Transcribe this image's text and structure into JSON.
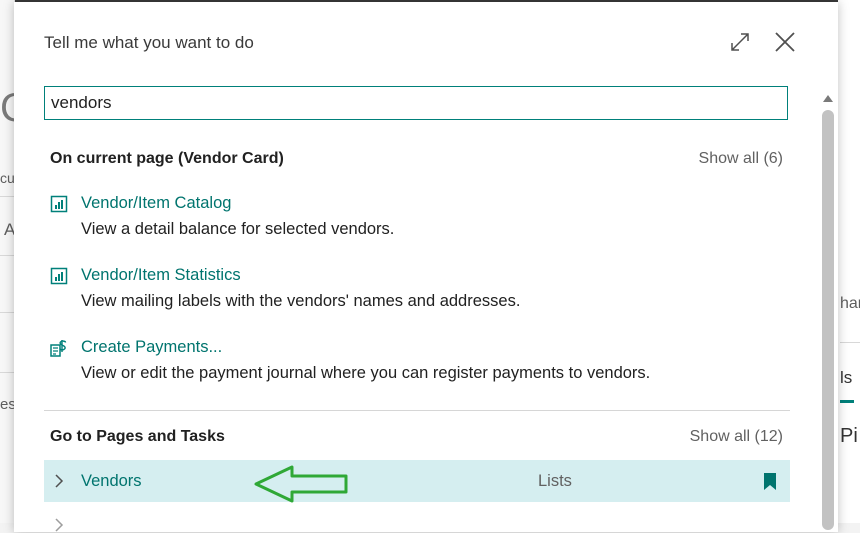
{
  "background": {
    "fragments": [
      "C",
      "cu",
      "A",
      "esi",
      "har",
      "ls",
      "Pi"
    ]
  },
  "dialog": {
    "title": "Tell me what you want to do",
    "expand_icon": "expand-icon",
    "close_icon": "close-icon"
  },
  "search": {
    "value": "vendors",
    "placeholder": ""
  },
  "current_page": {
    "heading": "On current page (Vendor Card)",
    "show_all": "Show all (6)",
    "items": [
      {
        "title": "Vendor/Item Catalog",
        "description": "View a detail balance for selected vendors.",
        "icon": "report-icon"
      },
      {
        "title": "Vendor/Item Statistics",
        "description": "View mailing labels with the vendors' names and addresses.",
        "icon": "report-icon"
      },
      {
        "title": "Create Payments...",
        "description": "View or edit the payment journal where you can register payments to vendors.",
        "icon": "payment-icon"
      }
    ]
  },
  "pages_tasks": {
    "heading": "Go to Pages and Tasks",
    "show_all": "Show all (12)",
    "rows": [
      {
        "label": "Vendors",
        "category": "Lists",
        "icon": "bookmark-icon",
        "selected": true
      }
    ]
  },
  "colors": {
    "accent": "#00807a",
    "link": "#00746e",
    "selected_row": "#d5eef0",
    "annotation_arrow": "#2fa836"
  }
}
